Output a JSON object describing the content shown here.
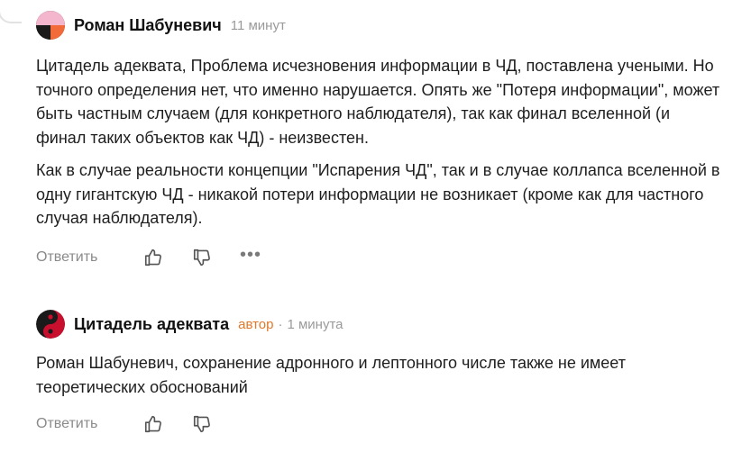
{
  "comments": [
    {
      "author": "Роман Шабуневич",
      "time": "11 минут",
      "paragraphs": [
        "Цитадель адеквата, Проблема исчезновения информации в ЧД, поставлена учеными. Но точного определения нет, что именно нарушается. Опять же \"Потеря информации\", может быть частным случаем (для конкретного наблюдателя), так как финал вселенной (и финал таких объектов как ЧД) - неизвестен.",
        "Как в случае реальности концепции \"Испарения ЧД\", так и в случае коллапса вселенной в одну гигантскую ЧД - никакой потери информации не возникает (кроме как для частного случая наблюдателя)."
      ],
      "reply_label": "Ответить",
      "more_label": "•••"
    },
    {
      "author": "Цитадель адеквата",
      "author_tag": "автор",
      "separator": "·",
      "time": "1 минута",
      "paragraphs": [
        "Роман Шабуневич, сохранение адронного и лептонного числе также не имеет теоретических обоснований"
      ],
      "reply_label": "Ответить"
    }
  ],
  "colors": {
    "author_tag": "#e0782a",
    "muted": "#9a9a9a",
    "text": "#1e1e1e"
  },
  "icons": [
    "like-icon",
    "dislike-icon",
    "more-icon",
    "avatar-pink",
    "avatar-yin-yang"
  ]
}
